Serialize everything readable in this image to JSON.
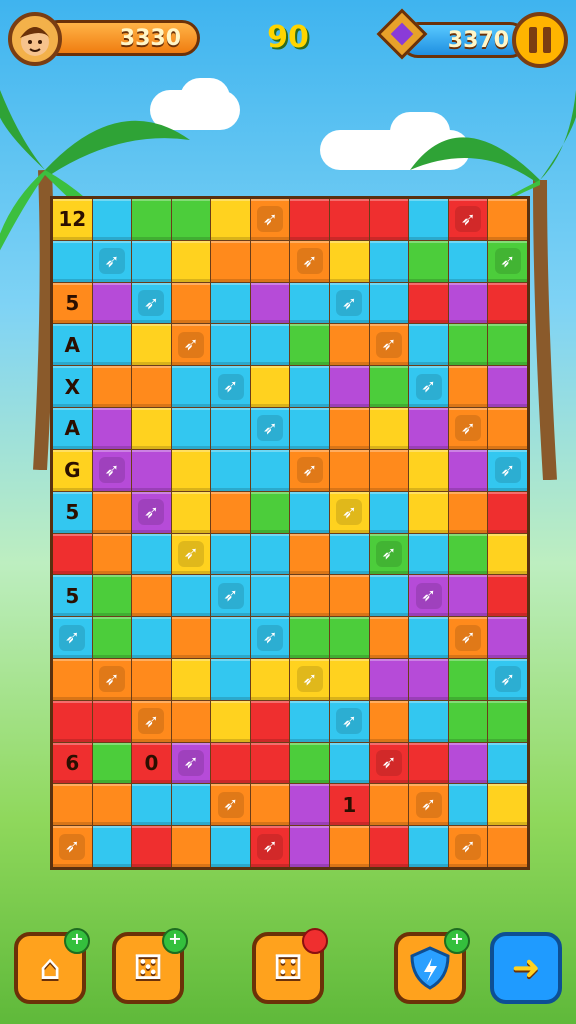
{
  "hud": {
    "coins": "3330",
    "score": "90",
    "gems": "3370"
  },
  "board": {
    "rows": [
      [
        "12",
        "",
        "",
        "",
        "",
        "",
        "",
        "",
        "",
        "",
        "",
        ""
      ],
      [
        "",
        "",
        "",
        "",
        "",
        "",
        "",
        "",
        "",
        "",
        "",
        ""
      ],
      [
        "5",
        "",
        "",
        "",
        "",
        "",
        "",
        "",
        "",
        "",
        "",
        ""
      ],
      [
        "A",
        "",
        "",
        "",
        "",
        "",
        "",
        "",
        "",
        "",
        "",
        ""
      ],
      [
        "X",
        "",
        "",
        "",
        "",
        "",
        "",
        "",
        "",
        "",
        "",
        ""
      ],
      [
        "A",
        "",
        "",
        "",
        "",
        "",
        "",
        "",
        "",
        "",
        "",
        ""
      ],
      [
        "G",
        "",
        "",
        "",
        "",
        "",
        "",
        "",
        "",
        "",
        "",
        ""
      ],
      [
        "5",
        "",
        "",
        "",
        "",
        "",
        "",
        "",
        "",
        "",
        "",
        ""
      ],
      [
        "",
        "",
        "",
        "",
        "",
        "",
        "",
        "",
        "",
        "",
        "",
        ""
      ],
      [
        "5",
        "",
        "",
        "",
        "",
        "",
        "",
        "",
        "",
        "",
        "",
        ""
      ],
      [
        "",
        "",
        "",
        "",
        "",
        "",
        "",
        "",
        "",
        "",
        "",
        ""
      ],
      [
        "",
        "",
        "",
        "",
        "",
        "",
        "",
        "",
        "",
        "",
        "",
        ""
      ],
      [
        "",
        "",
        "",
        "",
        "",
        "",
        "",
        "",
        "",
        "",
        "",
        ""
      ],
      [
        "6",
        "",
        "0",
        "",
        "",
        "",
        "",
        "",
        "",
        "",
        "",
        ""
      ],
      [
        "",
        "",
        "",
        "",
        "",
        "",
        "",
        "1",
        "",
        "",
        "",
        ""
      ],
      [
        "",
        "",
        "",
        "",
        "",
        "",
        "",
        "",
        "",
        "",
        "",
        ""
      ]
    ]
  },
  "colors": {
    "orange": "#ff8a1c",
    "yellow": "#ffd21f",
    "green": "#4ccd3b",
    "cyan": "#33c7f0",
    "red": "#ef2f2f",
    "purple": "#b64bd8",
    "pink": "#ff5fbf",
    "lightcyan": "#7fe0f5"
  },
  "buttons": [
    {
      "name": "home-button",
      "icon": "home-icon",
      "glyph": "⌂"
    },
    {
      "name": "dice-button-1",
      "icon": "dice-icon",
      "glyph": "⚄"
    },
    {
      "name": "dice-button-2",
      "icon": "dice-icon",
      "glyph": "⚃"
    },
    {
      "name": "shield-button",
      "icon": "shield-icon",
      "glyph": "🛡"
    },
    {
      "name": "next-button",
      "icon": "arrow-right-icon",
      "glyph": "➜"
    }
  ]
}
